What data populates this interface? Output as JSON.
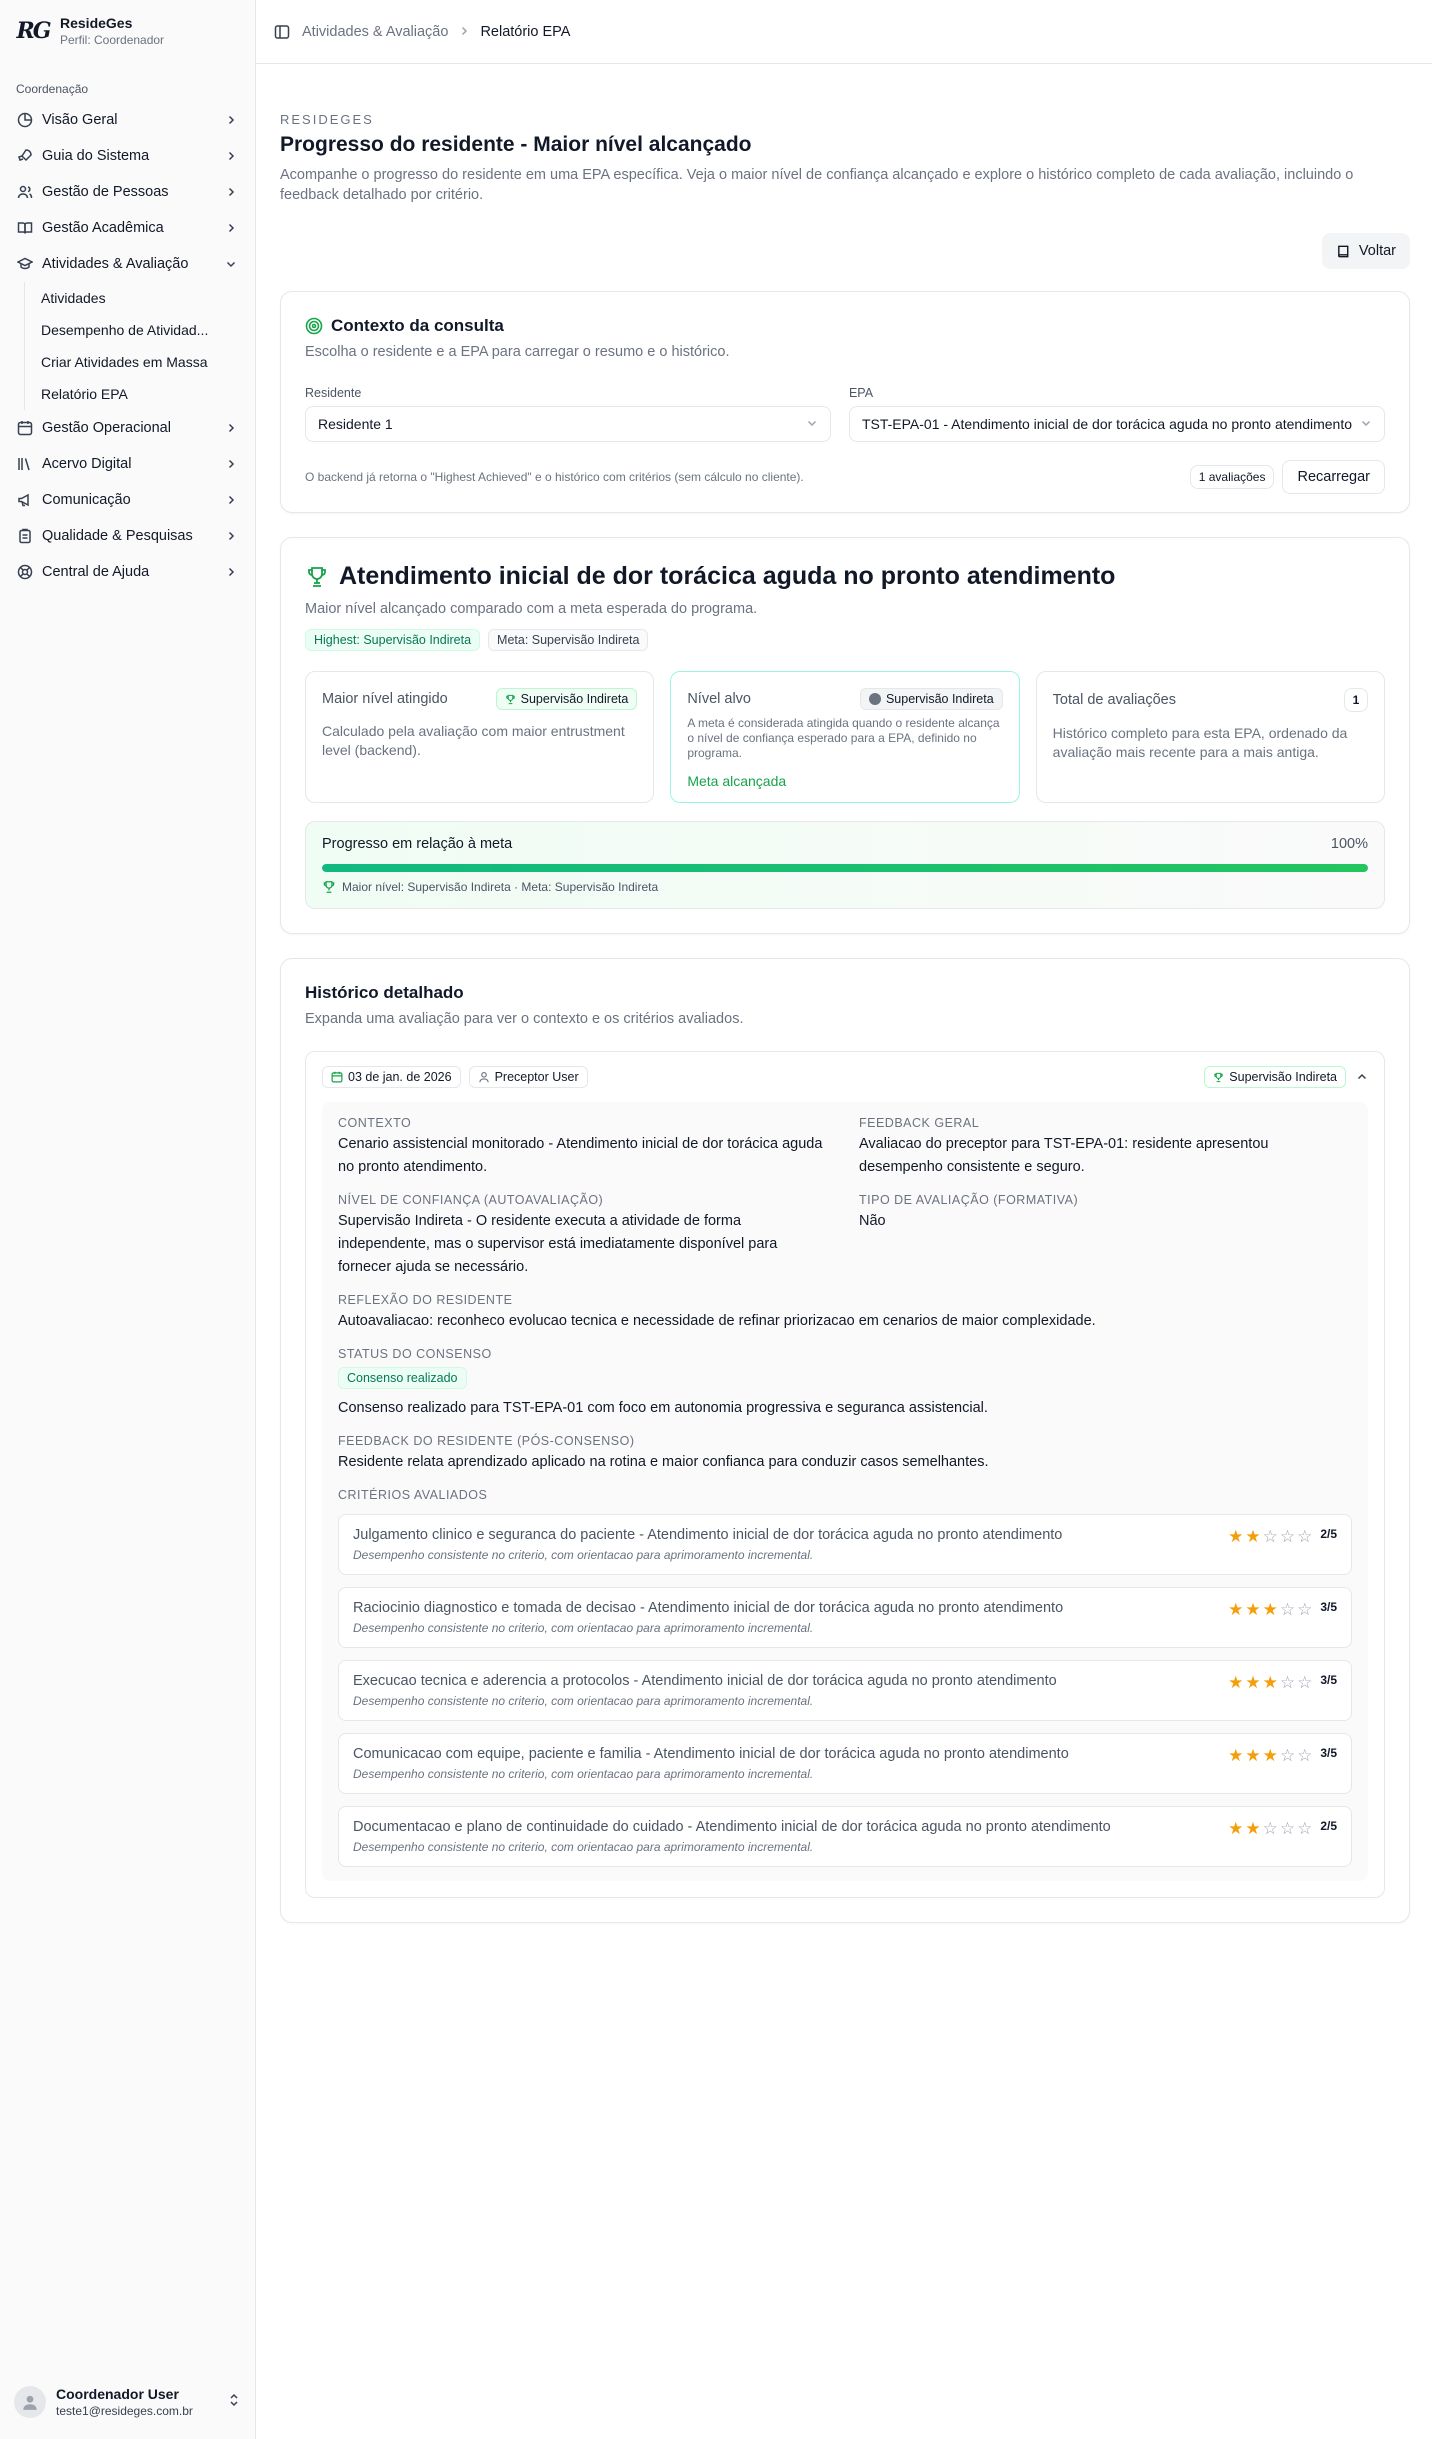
{
  "brand": {
    "name": "ResideGes",
    "profile": "Perfil: Coordenador",
    "logo": "RG"
  },
  "sidebar": {
    "section": "Coordenação",
    "items": [
      {
        "label": "Visão Geral",
        "icon": "pie-chart-icon"
      },
      {
        "label": "Guia do Sistema",
        "icon": "rocket-icon"
      },
      {
        "label": "Gestão de Pessoas",
        "icon": "users-icon"
      },
      {
        "label": "Gestão Acadêmica",
        "icon": "book-icon"
      },
      {
        "label": "Atividades & Avaliação",
        "icon": "graduation-cap-icon",
        "expanded": true
      },
      {
        "label": "Gestão Operacional",
        "icon": "calendar-icon"
      },
      {
        "label": "Acervo Digital",
        "icon": "library-icon"
      },
      {
        "label": "Comunicação",
        "icon": "megaphone-icon"
      },
      {
        "label": "Qualidade & Pesquisas",
        "icon": "clipboard-icon"
      },
      {
        "label": "Central de Ajuda",
        "icon": "lifebuoy-icon"
      }
    ],
    "subitems": [
      "Atividades",
      "Desempenho de Atividad...",
      "Criar Atividades em Massa",
      "Relatório EPA"
    ]
  },
  "user": {
    "name": "Coordenador User",
    "email": "teste1@resideges.com.br"
  },
  "breadcrumb": {
    "parent": "Atividades & Avaliação",
    "current": "Relatório EPA"
  },
  "header": {
    "eyebrow": "RESIDEGES",
    "title": "Progresso do residente - Maior nível alcançado",
    "description": "Acompanhe o progresso do residente em uma EPA específica. Veja o maior nível de confiança alcançado e explore o histórico completo de cada avaliação, incluindo o feedback detalhado por critério.",
    "back_label": "Voltar"
  },
  "context": {
    "title": "Contexto da consulta",
    "subtitle": "Escolha o residente e a EPA para carregar o resumo e o histórico.",
    "resident_label": "Residente",
    "resident_value": "Residente 1",
    "epa_label": "EPA",
    "epa_value": "TST-EPA-01 - Atendimento inicial de dor torácica aguda no pronto atendimento",
    "note": "O backend já retorna o \"Highest Achieved\" e o histórico com critérios (sem cálculo no cliente).",
    "count_badge": "1 avaliações",
    "reload_label": "Recarregar"
  },
  "epa": {
    "title": "Atendimento inicial de dor torácica aguda no pronto atendimento",
    "subtitle": "Maior nível alcançado comparado com a meta esperada do programa.",
    "highest_badge": "Highest: Supervisão Indireta",
    "target_badge": "Meta: Supervisão Indireta",
    "stat_highest": {
      "title": "Maior nível atingido",
      "badge": "Supervisão Indireta",
      "text": "Calculado pela avaliação com maior entrustment level (backend)."
    },
    "stat_target": {
      "title": "Nível alvo",
      "badge": "Supervisão Indireta",
      "text": "A meta é considerada atingida quando o residente alcança o nível de confiança esperado para a EPA, definido no programa.",
      "status": "Meta alcançada"
    },
    "stat_total": {
      "title": "Total de avaliações",
      "count": "1",
      "text": "Histórico completo para esta EPA, ordenado da avaliação mais recente para a mais antiga."
    },
    "progress": {
      "label": "Progresso em relação à meta",
      "percent_label": "100%",
      "value": 1.0,
      "footer": "Maior nível: Supervisão Indireta · Meta: Supervisão Indireta"
    }
  },
  "history": {
    "title": "Histórico detalhado",
    "subtitle": "Expanda uma avaliação para ver o contexto e os critérios avaliados.",
    "entry": {
      "date": "03 de jan. de 2026",
      "preceptor": "Preceptor User",
      "level": "Supervisão Indireta",
      "context_label": "CONTEXTO",
      "context_value": "Cenario assistencial monitorado - Atendimento inicial de dor torácica aguda no pronto atendimento.",
      "feedback_label": "FEEDBACK GERAL",
      "feedback_value": "Avaliacao do preceptor para TST-EPA-01: residente apresentou desempenho consistente e seguro.",
      "trust_label": "NÍVEL DE CONFIANÇA (AUTOAVALIAÇÃO)",
      "trust_value": "Supervisão Indireta - O residente executa a atividade de forma independente, mas o supervisor está imediatamente disponível para fornecer ajuda se necessário.",
      "type_label": "TIPO DE AVALIAÇÃO (FORMATIVA)",
      "type_value": "Não",
      "reflection_label": "REFLEXÃO DO RESIDENTE",
      "reflection_value": "Autoavaliacao: reconheco evolucao tecnica e necessidade de refinar priorizacao em cenarios de maior complexidade.",
      "consensus_label": "STATUS DO CONSENSO",
      "consensus_badge": "Consenso realizado",
      "consensus_value": "Consenso realizado para TST-EPA-01 com foco em autonomia progressiva e seguranca assistencial.",
      "resident_feedback_label": "FEEDBACK DO RESIDENTE (PÓS-CONSENSO)",
      "resident_feedback_value": "Residente relata aprendizado aplicado na rotina e maior confianca para conduzir casos semelhantes.",
      "criteria_label": "CRITÉRIOS AVALIADOS",
      "criteria": [
        {
          "title": "Julgamento clinico e seguranca do paciente - Atendimento inicial de dor torácica aguda no pronto atendimento",
          "note": "Desempenho consistente no criterio, com orientacao para aprimoramento incremental.",
          "score": 2,
          "score_label": "2/5"
        },
        {
          "title": "Raciocinio diagnostico e tomada de decisao - Atendimento inicial de dor torácica aguda no pronto atendimento",
          "note": "Desempenho consistente no criterio, com orientacao para aprimoramento incremental.",
          "score": 3,
          "score_label": "3/5"
        },
        {
          "title": "Execucao tecnica e aderencia a protocolos - Atendimento inicial de dor torácica aguda no pronto atendimento",
          "note": "Desempenho consistente no criterio, com orientacao para aprimoramento incremental.",
          "score": 3,
          "score_label": "3/5"
        },
        {
          "title": "Comunicacao com equipe, paciente e familia - Atendimento inicial de dor torácica aguda no pronto atendimento",
          "note": "Desempenho consistente no criterio, com orientacao para aprimoramento incremental.",
          "score": 3,
          "score_label": "3/5"
        },
        {
          "title": "Documentacao e plano de continuidade do cuidado - Atendimento inicial de dor torácica aguda no pronto atendimento",
          "note": "Desempenho consistente no criterio, com orientacao para aprimoramento incremental.",
          "score": 2,
          "score_label": "2/5"
        }
      ]
    }
  },
  "colors": {
    "accent_green": "#16a34a",
    "star": "#f59e0b",
    "progress": "#10b981"
  }
}
